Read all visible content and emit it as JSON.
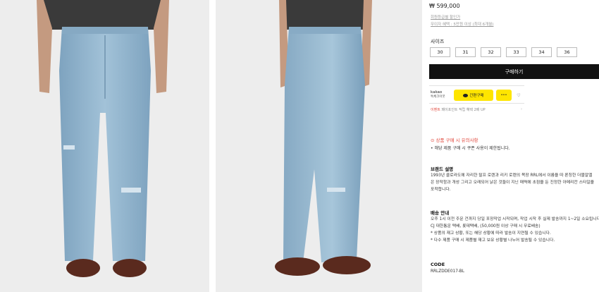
{
  "product": {
    "price": "₩ 599,000",
    "link_member_price": "회원등급별 할인가",
    "link_benefit": "무이자 혜택 : 5만원 이상 (최대 6개월)"
  },
  "size_selector": {
    "label": "사이즈",
    "options": [
      "30",
      "31",
      "32",
      "33",
      "34",
      "36"
    ]
  },
  "buy_button": "구매하기",
  "kakao": {
    "logo_top": "kakao",
    "logo_sub": "톡체크아웃",
    "pay_label": "간편구매",
    "more_label": "•••",
    "event_tag": "이벤트",
    "event_text": "페이포인트 적립 혜택 2배 UP",
    "event_arrow": "›"
  },
  "notice": {
    "title": "⊙ 상품 구매 시 유의사항",
    "text": "• 해당 제품 구매 시 쿠폰 사용이 제한됩니다."
  },
  "brand": {
    "title": "브랜드 설명",
    "lines": [
      "1993년 콜로라도에 자리한 랄프 로렌과 리키 로렌의 목장 RRL에서 이름을 따 론칭한 더블알엘",
      "은 장작함과 개성 그리고 오래되어 낡은 것들이 지닌 매력에 초점을 둔 진정한 아메리칸 스타일을",
      "포착합니다."
    ]
  },
  "delivery": {
    "title": "배송 안내",
    "lines": [
      "오후 1시 이전 주문 건까지 당일 포장작업 시작되며, 작업 시작 후 실제 발송까지 1~2일 소요됩니다.",
      "CJ 대한통운 택배, 롯데택배, (50,000원 이상 구매 시 무료배송)",
      "* 상품의 재고 상황, 또는 해당 상황에 따라 발송이 지연될 수 있습니다.",
      "* 다수 제품 구매 시 제품별 재고 보유 상황별 나누어 발송될 수 있습니다."
    ]
  },
  "code": {
    "title": "CODE",
    "value": "RRLZDDE017-BL"
  },
  "colors": {
    "photo_bg": "#ededed",
    "denim": "#8fb2cc",
    "shirt": "#3a3a3a",
    "shoe": "#5a2a1e",
    "buy_bg": "#111111",
    "kakao_yellow": "#fee500",
    "notice_red": "#e0453a"
  }
}
